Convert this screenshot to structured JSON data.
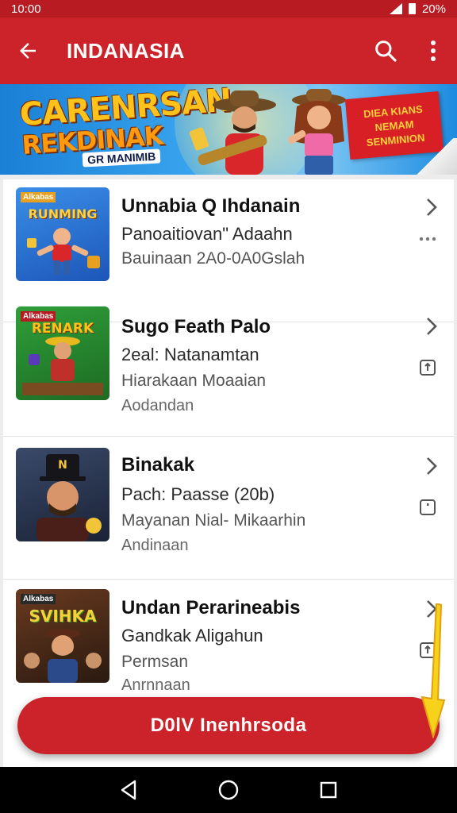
{
  "status": {
    "time": "10:00",
    "right": "20%"
  },
  "app_bar": {
    "title": "INDANASIA",
    "back_icon": "arrow-left-icon",
    "search_icon": "search-icon",
    "menu_icon": "more-vert-icon"
  },
  "banner": {
    "title_line1": "CARENRSAN",
    "title_line2": "REKDINAK",
    "subtitle": "GR MANIMIB",
    "badge": "DIEA KIANS NEMAM SENMINION"
  },
  "items": [
    {
      "thumb_label": "Alkabas",
      "thumb_title": "RUNMING",
      "title": "Unnabia Q Ihdanain",
      "line2": "Panoaitiovan\" Adaahn",
      "line3": "Bauinaan 2A0-0A0Gslah",
      "line4": "",
      "side_icon": "more-horiz-icon"
    },
    {
      "thumb_label": "Alkabas",
      "thumb_title": "RENARK",
      "title": "Sugo Feath Palo",
      "line2": "2eal: Natanamtan",
      "line3": "Hiarakaan Moaaian",
      "line4": "Aodandan",
      "side_icon": "share-icon"
    },
    {
      "thumb_label": "",
      "thumb_title": "N",
      "title": "Binakak",
      "line2": "Pach: Paasse (20b)",
      "line3": "Mayanan Nial- Mikaarhin",
      "line4": "Andinaan",
      "side_icon": "info-icon"
    },
    {
      "thumb_label": "Alkabas",
      "thumb_title": "SVIHKA",
      "title": "Undan Perarineabis",
      "line2": "Gandkak Aligahun",
      "line3": "Permsan",
      "line4": "Anrnnaan",
      "side_icon": "share-icon"
    }
  ],
  "fab": {
    "label": "D0lV Inenhrsoda"
  },
  "nav": {
    "back": "nav-back-icon",
    "home": "nav-home-icon",
    "recents": "nav-recents-icon"
  }
}
